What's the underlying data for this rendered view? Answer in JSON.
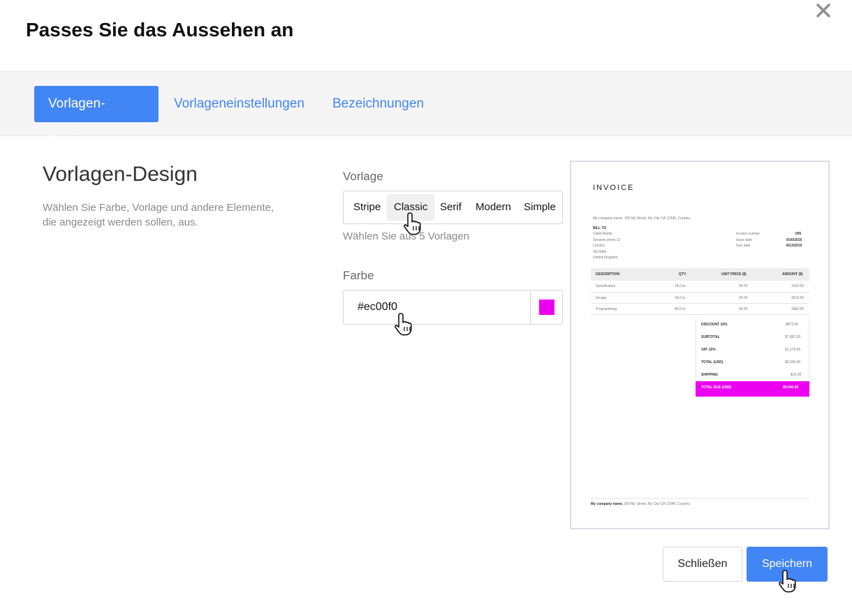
{
  "dialog": {
    "title": "Passes Sie das Aussehen an"
  },
  "tabs": [
    {
      "label": "Vorlagen-Design",
      "active": true
    },
    {
      "label": "Vorlageneinstellungen",
      "active": false
    },
    {
      "label": "Bezeichnungen",
      "active": false
    }
  ],
  "section": {
    "title": "Vorlagen-Design",
    "description": "Wählen Sie Farbe, Vorlage und andere Elemente, die angezeigt werden sollen, aus."
  },
  "template": {
    "label": "Vorlage",
    "options": [
      "Stripe",
      "Classic",
      "Serif",
      "Modern",
      "Simple"
    ],
    "selected": "Classic",
    "hint": "Wählen Sie aus 5 Vorlagen"
  },
  "color": {
    "label": "Farbe",
    "value": "#ec00f0",
    "accent": "#4285f4"
  },
  "invoice_preview": {
    "title": "INVOICE",
    "company_line": "My company name, 300 My Street, My City CA 12345, Country",
    "bill_to_label": "BILL TO",
    "bill_to": [
      "Client Martin",
      "Sesame street 12",
      "London",
      "SE10AA",
      "United Kingdom"
    ],
    "meta": [
      {
        "label": "Invoice number",
        "value": "005"
      },
      {
        "label": "Issue date",
        "value": "6/30/2016"
      },
      {
        "label": "Due date",
        "value": "8/13/2016"
      }
    ],
    "columns": [
      "DESCRIPTION",
      "QTY.",
      "UNIT PRICE ($)",
      "AMOUNT ($)"
    ],
    "rows": [
      {
        "description": "Specification",
        "qty": "18.0 hr.",
        "unit_price": "90.00",
        "amount": "1620.00"
      },
      {
        "description": "Design",
        "qty": "39.0 hr.",
        "unit_price": "90.00",
        "amount": "3510.00"
      },
      {
        "description": "Programming",
        "qty": "40.0 hr.",
        "unit_price": "90.00",
        "amount": "3600.00"
      }
    ],
    "totals": [
      {
        "label": "DISCOUNT 10%",
        "value": "$873.00"
      },
      {
        "label": "SUBTOTAL",
        "value": "$7,857.00"
      },
      {
        "label": "VAT 15%",
        "value": "$1,178.55"
      },
      {
        "label": "TOTAL (USD)",
        "value": "$9,035.00"
      },
      {
        "label": "SHIPPING",
        "value": "$10.00"
      }
    ],
    "total_due": {
      "label": "TOTAL DUE (USD)",
      "value": "$9,045.00"
    },
    "footer_bold": "My company name,",
    "footer_rest": " 300 My Street, My City CA 12345, Country"
  },
  "buttons": {
    "close": "Schließen",
    "save": "Speichern"
  },
  "icons": {
    "close": "close-icon",
    "cursor": "hand-pointer-icon"
  }
}
